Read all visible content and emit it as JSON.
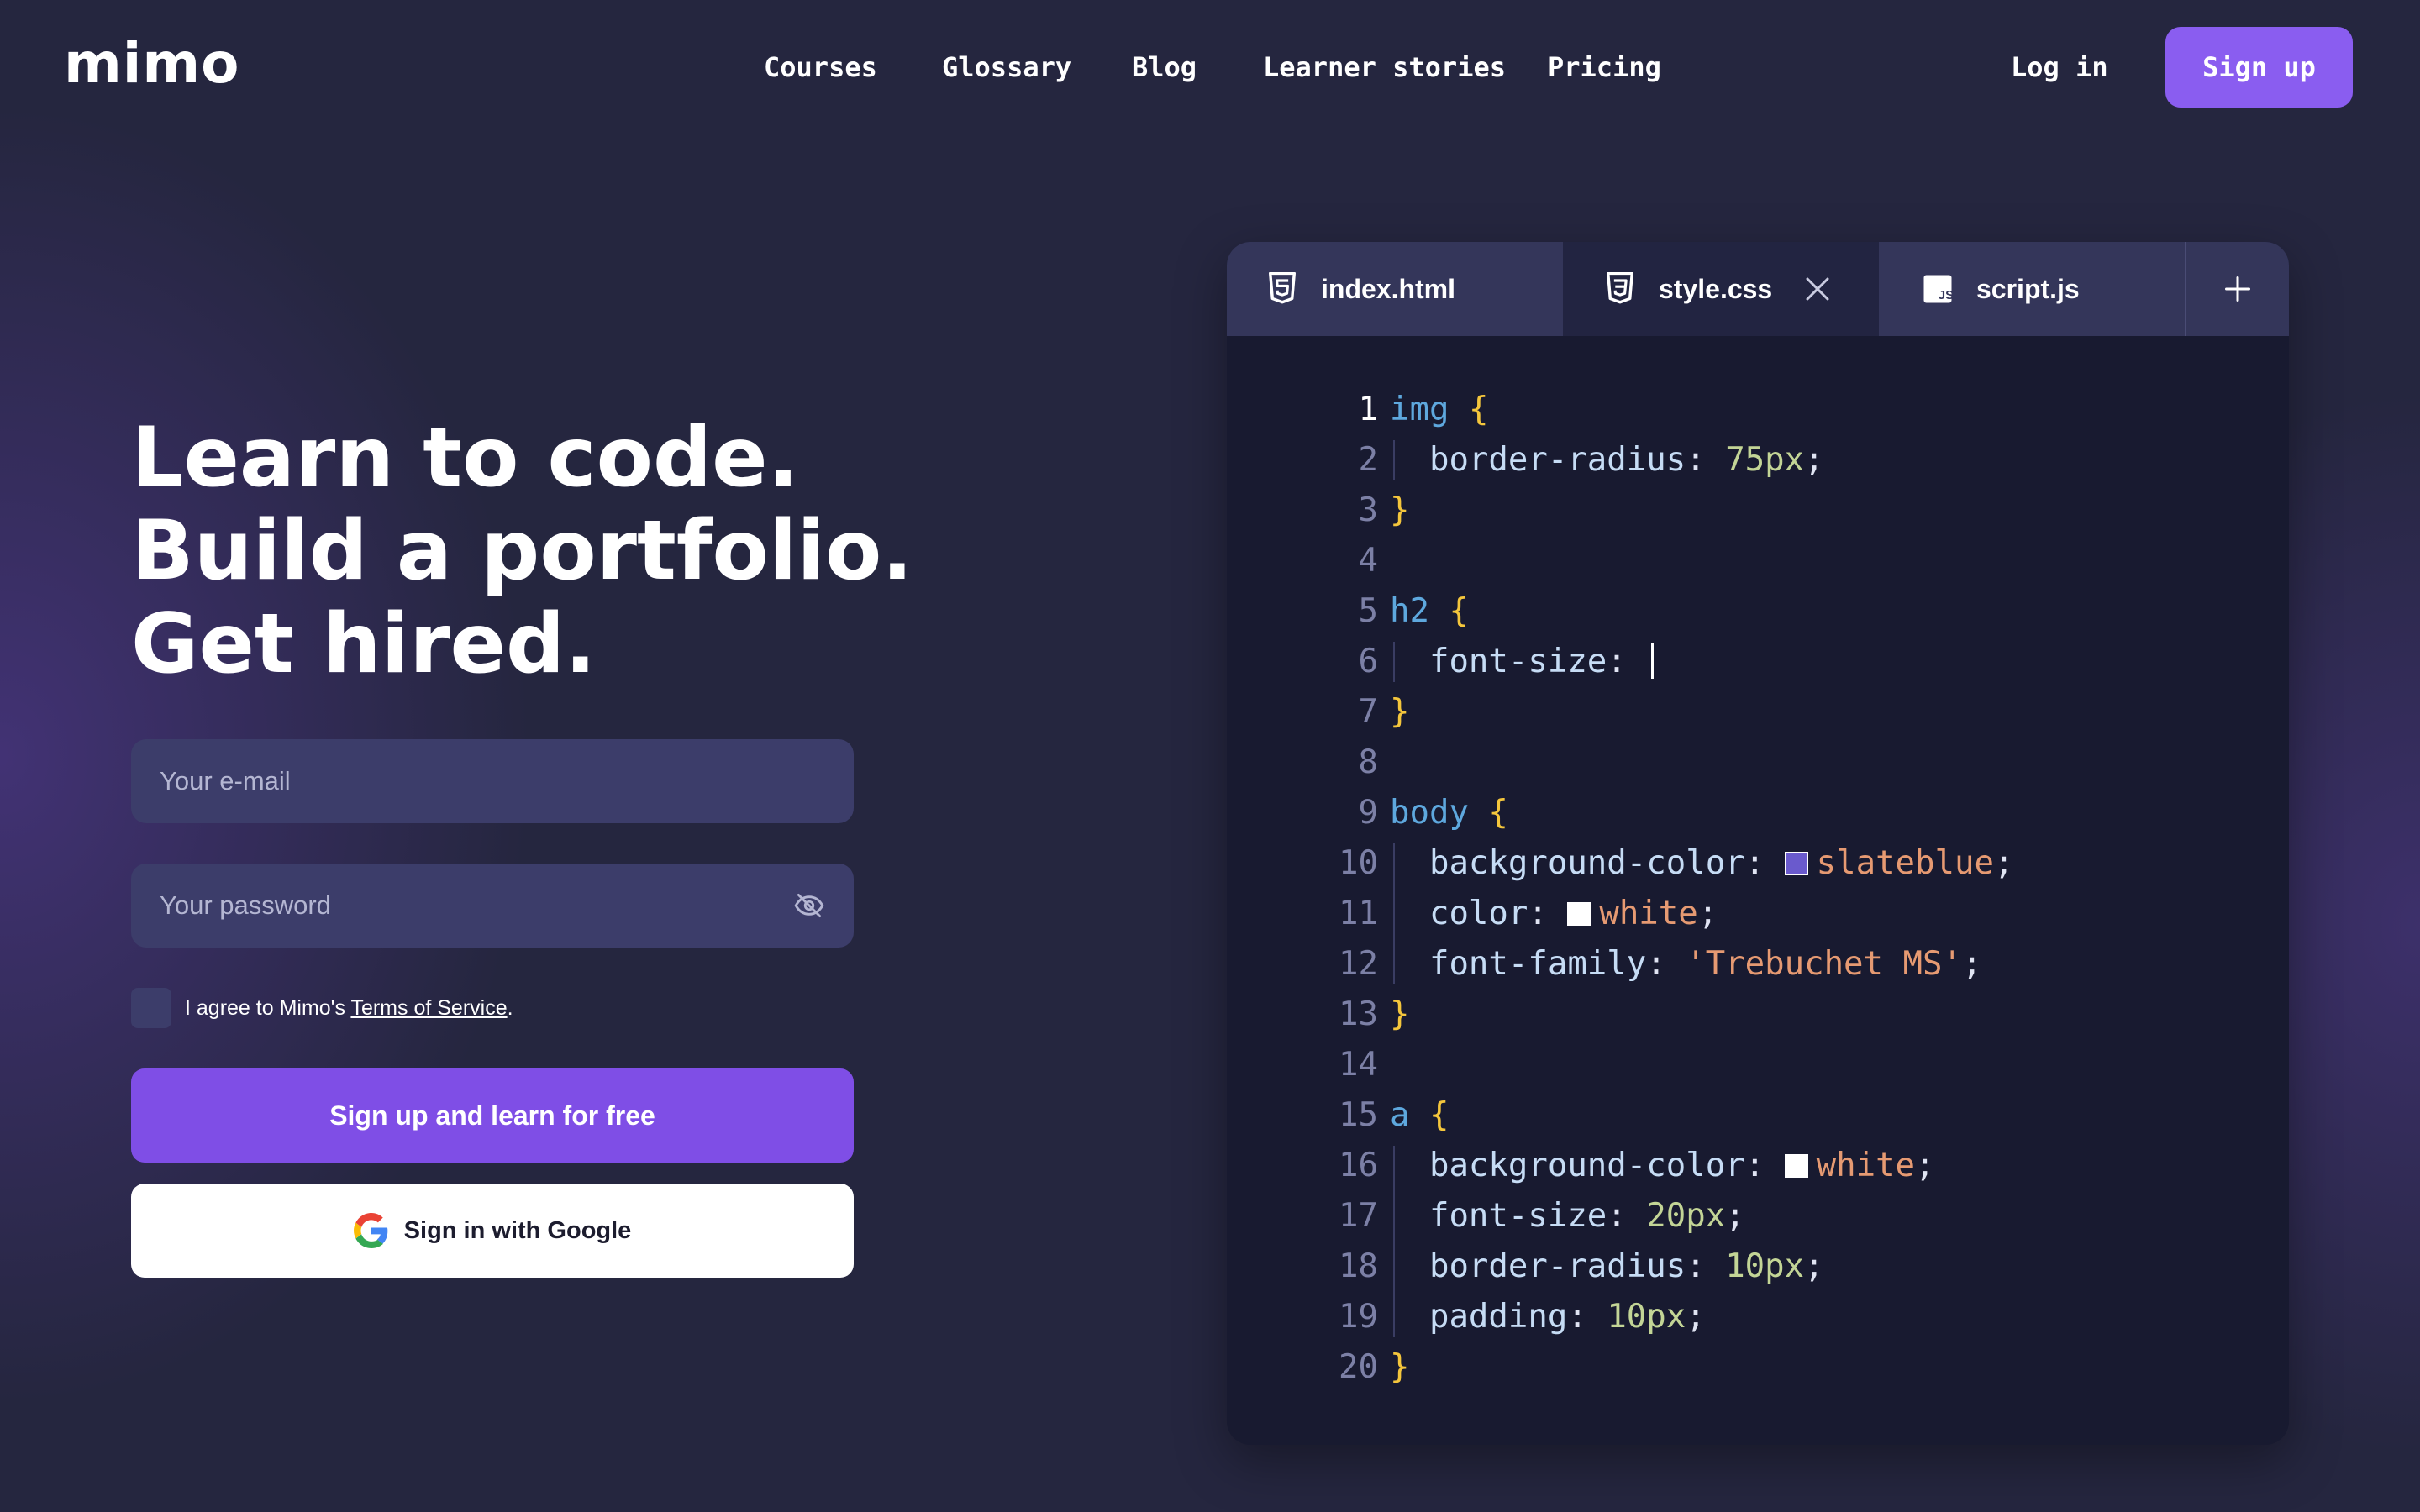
{
  "brand": {
    "logo_text": "mimo"
  },
  "nav": {
    "items": [
      {
        "label": "Courses"
      },
      {
        "label": "Glossary"
      },
      {
        "label": "Blog"
      },
      {
        "label": "Learner stories"
      },
      {
        "label": "Pricing"
      }
    ],
    "login_label": "Log in",
    "signup_label": "Sign up"
  },
  "hero": {
    "lines": [
      "Learn to code.",
      "Build a portfolio.",
      "Get hired."
    ]
  },
  "form": {
    "email_placeholder": "Your e-mail",
    "password_placeholder": "Your password",
    "agree_prefix": "I agree to Mimo's ",
    "terms_link": "Terms of Service",
    "agree_suffix": ".",
    "submit_label": "Sign up and learn for free",
    "google_label": "Sign in with Google"
  },
  "editor": {
    "tabs": [
      {
        "label": "index.html",
        "icon": "html5-icon"
      },
      {
        "label": "style.css",
        "icon": "css3-icon",
        "active": true
      },
      {
        "label": "script.js",
        "icon": "js-icon"
      }
    ],
    "active_file": "style.css",
    "code_lines": [
      "img {",
      "  border-radius: 75px;",
      "}",
      "",
      "h2 {",
      "  font-size: ",
      "}",
      "",
      "body {",
      "  background-color: slateblue;",
      "  color: white;",
      "  font-family: 'Trebuchet MS';",
      "}",
      "",
      "a {",
      "  background-color: white;",
      "  font-size: 20px;",
      "  border-radius: 10px;",
      "  padding: 10px;",
      "}"
    ],
    "tokens": {
      "l1_sel": "img",
      "l1_brace": "{",
      "l2_prop": "border-radius",
      "l2_val": "75px",
      "l3_brace": "}",
      "l5_sel": "h2",
      "l5_brace": "{",
      "l6_prop": "font-size",
      "l7_brace": "}",
      "l9_sel": "body",
      "l9_brace": "{",
      "l10_prop": "background-color",
      "l10_val": "slateblue",
      "l11_prop": "color",
      "l11_val": "white",
      "l12_prop": "font-family",
      "l12_val": "'Trebuchet MS'",
      "l13_brace": "}",
      "l15_sel": "a",
      "l15_brace": "{",
      "l16_prop": "background-color",
      "l16_val": "white",
      "l17_prop": "font-size",
      "l17_val": "20px",
      "l18_prop": "border-radius",
      "l18_val": "10px",
      "l19_prop": "padding",
      "l19_val": "10px",
      "l20_brace": "}"
    }
  },
  "colors": {
    "accent": "#8a5df0",
    "primary_button": "#7f4ee6",
    "background": "#25263f",
    "editor_bg": "#181a30",
    "swatch_slateblue": "#6a5acd",
    "swatch_white": "#ffffff"
  }
}
